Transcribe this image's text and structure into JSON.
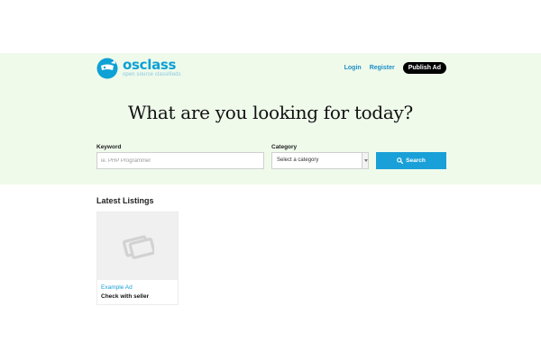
{
  "brand": {
    "name": "osclass",
    "tagline": "open source classifieds"
  },
  "nav": {
    "login": "Login",
    "register": "Register",
    "publish": "Publish Ad"
  },
  "hero": {
    "headline": "What are you looking for today?"
  },
  "search": {
    "keyword_label": "Keyword",
    "keyword_placeholder": "ie. PHP Programmer",
    "category_label": "Category",
    "category_selected": "Select a category",
    "button_label": "Search"
  },
  "listings": {
    "title": "Latest Listings",
    "items": [
      {
        "category": "Example Ad",
        "price": "Check with seller"
      }
    ]
  },
  "colors": {
    "accent": "#1aa0d8",
    "hero_bg": "#effaeb",
    "publish_bg": "#000000"
  }
}
